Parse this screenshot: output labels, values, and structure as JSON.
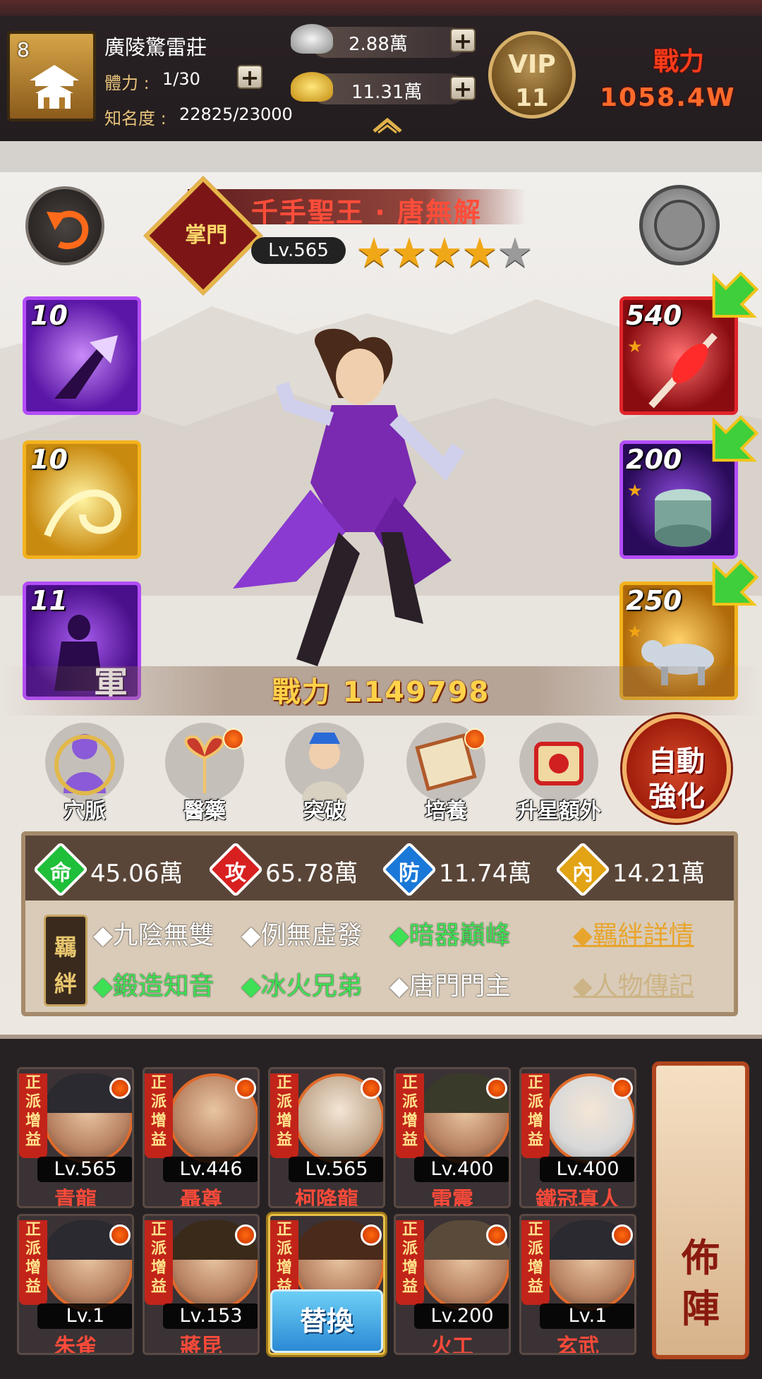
{
  "header": {
    "player_level": "8",
    "guild_name": "廣陵驚雷莊",
    "stamina_label": "體力 :",
    "stamina_value": "1/30",
    "fame_label": "知名度 :",
    "fame_value": "22825/23000",
    "silver": "2.88萬",
    "gold": "11.31萬",
    "vip_label": "VIP",
    "vip_level": "11",
    "power_label": "戰力",
    "power_value": "1058.4W"
  },
  "hero": {
    "sect_badge": "掌門",
    "name": "千手聖王 · 唐無解",
    "level": "Lv.565",
    "stars_filled": 4,
    "stars_total": 5,
    "power": "戰力 1149798"
  },
  "skills": [
    {
      "level": "10",
      "icon": "purple-dart-icon",
      "color": "#9b3cf0"
    },
    {
      "level": "10",
      "icon": "golden-swirl-icon",
      "color": "#f0a818"
    },
    {
      "level": "11",
      "icon": "army-skill-icon",
      "color": "#9b3cf0",
      "tag": "軍"
    }
  ],
  "equipment": [
    {
      "level": "540",
      "icon": "red-weapon-icon",
      "color": "#e0242a"
    },
    {
      "level": "200",
      "icon": "jade-ring-icon",
      "color": "#9b3cf0"
    },
    {
      "level": "250",
      "icon": "silver-beast-icon",
      "color": "#f0a818"
    }
  ],
  "functions": [
    {
      "label": "穴脈",
      "icon": "meridian-icon",
      "dot": false
    },
    {
      "label": "醫藥",
      "icon": "medicine-icon",
      "dot": true
    },
    {
      "label": "突破",
      "icon": "breakthrough-icon",
      "dot": false
    },
    {
      "label": "培養",
      "icon": "cultivate-scroll-icon",
      "dot": true
    },
    {
      "label": "升星額外",
      "icon": "star-upgrade-icon",
      "dot": false
    }
  ],
  "auto_enhance": [
    "自動",
    "強化"
  ],
  "stats": [
    {
      "glyph": "命",
      "value": "45.06萬",
      "color": "#1fbf3a"
    },
    {
      "glyph": "攻",
      "value": "65.78萬",
      "color": "#d82020"
    },
    {
      "glyph": "防",
      "value": "11.74萬",
      "color": "#1a78d8"
    },
    {
      "glyph": "內",
      "value": "14.21萬",
      "color": "#e2a314"
    }
  ],
  "bonds": {
    "tag": [
      "羈",
      "絆"
    ],
    "row1": [
      {
        "text": "◆九陰無雙",
        "active": false
      },
      {
        "text": "◆例無虛發",
        "active": false
      },
      {
        "text": "◆暗器巔峰",
        "active": true
      }
    ],
    "row2": [
      {
        "text": "◆鍛造知音",
        "active": true
      },
      {
        "text": "◆冰火兄弟",
        "active": true
      },
      {
        "text": "◆唐門門主",
        "active": false
      }
    ],
    "detail_link": "◆羈絆詳情",
    "bio_link": "◆人物傳記"
  },
  "roster": {
    "ribbon": [
      "正",
      "派",
      "增",
      "益"
    ],
    "swap_label": "替換",
    "formation_label": [
      "佈",
      "陣"
    ],
    "heroes": [
      {
        "level": "Lv.565",
        "name": "青龍"
      },
      {
        "level": "Lv.446",
        "name": "聶尊"
      },
      {
        "level": "Lv.565",
        "name": "柯降龍"
      },
      {
        "level": "Lv.400",
        "name": "雷震"
      },
      {
        "level": "Lv.400",
        "name": "鐵冠真人"
      },
      {
        "level": "Lv.1",
        "name": "朱雀"
      },
      {
        "level": "Lv.153",
        "name": "蔣昆"
      },
      {
        "level": "",
        "name": ""
      },
      {
        "level": "Lv.200",
        "name": "火工"
      },
      {
        "level": "Lv.1",
        "name": "玄武"
      }
    ]
  }
}
